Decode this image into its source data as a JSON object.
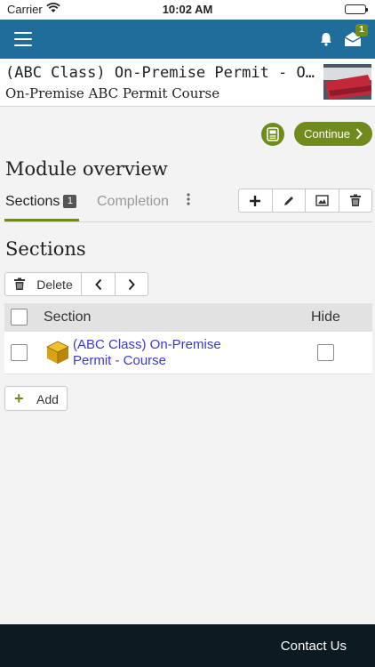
{
  "status_bar": {
    "carrier": "Carrier",
    "time": "10:02 AM"
  },
  "navbar": {
    "mail_badge": "1"
  },
  "course": {
    "title": "(ABC Class) On-Premise Permit - O...",
    "subtitle": "On-Premise ABC Permit Course"
  },
  "actions": {
    "continue_label": "Continue"
  },
  "module": {
    "title": "Module overview"
  },
  "tabs": [
    {
      "label": "Sections",
      "count": "1"
    },
    {
      "label": "Completion"
    }
  ],
  "sections": {
    "title": "Sections",
    "bulk_delete_label": "Delete",
    "columns": {
      "section": "Section",
      "hide": "Hide"
    },
    "rows": [
      {
        "name": "(ABC Class) On-Premise Permit - Course",
        "hidden": false
      }
    ],
    "add_label": "Add"
  },
  "footer": {
    "contact_label": "Contact Us"
  },
  "colors": {
    "accent": "#6f8b1c",
    "navbar": "#1f6d9a",
    "footer": "#0c1a22",
    "link": "#3a3ad0"
  },
  "icons": [
    "wifi-icon",
    "battery-icon",
    "menu-icon",
    "bell-icon",
    "mail-icon",
    "save-icon",
    "chevron-right-icon",
    "kebab-icon",
    "plus-icon",
    "pencil-icon",
    "image-icon",
    "trash-icon",
    "chevron-left-icon",
    "cube-icon"
  ]
}
